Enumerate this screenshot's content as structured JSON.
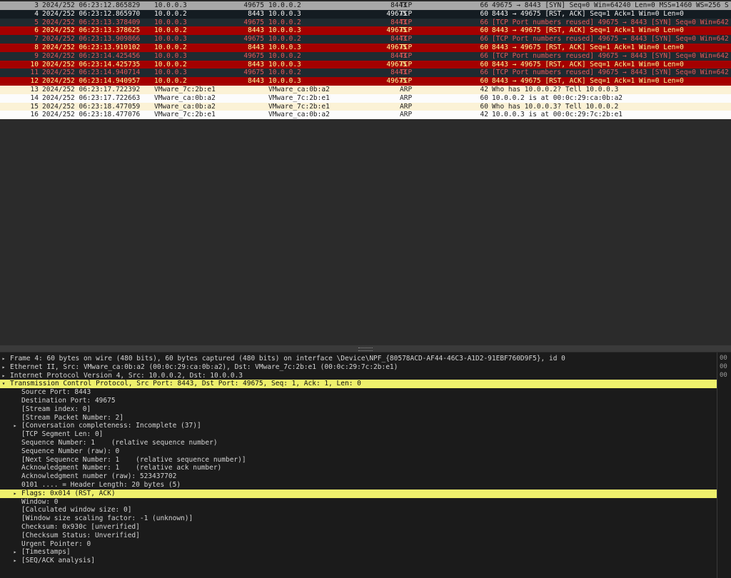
{
  "packets": [
    {
      "no": "3",
      "time": "2024/252 06:23:12.865829",
      "src": "10.0.0.3",
      "sport": "49675",
      "dst": "10.0.0.2",
      "dport": "8443",
      "proto": "TCP",
      "len": "66",
      "info": "49675 → 8443 [SYN] Seq=0 Win=64240 Len=0 MSS=1460 WS=256 S",
      "style": "gray"
    },
    {
      "no": "4",
      "time": "2024/252 06:23:12.865970",
      "src": "10.0.0.2",
      "sport": "8443",
      "dst": "10.0.0.3",
      "dport": "49675",
      "proto": "TCP",
      "len": "60",
      "info": "8443 → 49675 [RST, ACK] Seq=1 Ack=1 Win=0 Len=0",
      "style": "dark"
    },
    {
      "no": "5",
      "time": "2024/252 06:23:13.378409",
      "src": "10.0.0.3",
      "sport": "49675",
      "dst": "10.0.0.2",
      "dport": "8443",
      "proto": "TCP",
      "len": "66",
      "info": "[TCP Port numbers reused] 49675 → 8443 [SYN] Seq=0 Win=642",
      "style": "slate"
    },
    {
      "no": "6",
      "time": "2024/252 06:23:13.378625",
      "src": "10.0.0.2",
      "sport": "8443",
      "dst": "10.0.0.3",
      "dport": "49675",
      "proto": "TCP",
      "len": "60",
      "info": "8443 → 49675 [RST, ACK] Seq=1 Ack=1 Win=0 Len=0",
      "style": "red"
    },
    {
      "no": "7",
      "time": "2024/252 06:23:13.909866",
      "src": "10.0.0.3",
      "sport": "49675",
      "dst": "10.0.0.2",
      "dport": "8443",
      "proto": "TCP",
      "len": "66",
      "info": "[TCP Port numbers reused] 49675 → 8443 [SYN] Seq=0 Win=642",
      "style": "slate"
    },
    {
      "no": "8",
      "time": "2024/252 06:23:13.910102",
      "src": "10.0.0.2",
      "sport": "8443",
      "dst": "10.0.0.3",
      "dport": "49675",
      "proto": "TCP",
      "len": "60",
      "info": "8443 → 49675 [RST, ACK] Seq=1 Ack=1 Win=0 Len=0",
      "style": "red"
    },
    {
      "no": "9",
      "time": "2024/252 06:23:14.425456",
      "src": "10.0.0.3",
      "sport": "49675",
      "dst": "10.0.0.2",
      "dport": "8443",
      "proto": "TCP",
      "len": "66",
      "info": "[TCP Port numbers reused] 49675 → 8443 [SYN] Seq=0 Win=642",
      "style": "slate"
    },
    {
      "no": "10",
      "time": "2024/252 06:23:14.425735",
      "src": "10.0.0.2",
      "sport": "8443",
      "dst": "10.0.0.3",
      "dport": "49675",
      "proto": "TCP",
      "len": "60",
      "info": "8443 → 49675 [RST, ACK] Seq=1 Ack=1 Win=0 Len=0",
      "style": "red"
    },
    {
      "no": "11",
      "time": "2024/252 06:23:14.940714",
      "src": "10.0.0.3",
      "sport": "49675",
      "dst": "10.0.0.2",
      "dport": "8443",
      "proto": "TCP",
      "len": "66",
      "info": "[TCP Port numbers reused] 49675 → 8443 [SYN] Seq=0 Win=642",
      "style": "slate"
    },
    {
      "no": "12",
      "time": "2024/252 06:23:14.940957",
      "src": "10.0.0.2",
      "sport": "8443",
      "dst": "10.0.0.3",
      "dport": "49675",
      "proto": "TCP",
      "len": "60",
      "info": "8443 → 49675 [RST, ACK] Seq=1 Ack=1 Win=0 Len=0",
      "style": "red"
    },
    {
      "no": "13",
      "time": "2024/252 06:23:17.722392",
      "src": "VMware_7c:2b:e1",
      "sport": "",
      "dst": "VMware_ca:0b:a2",
      "dport": "",
      "proto": "ARP",
      "len": "42",
      "info": "Who has 10.0.0.2? Tell 10.0.0.3",
      "style": "cream"
    },
    {
      "no": "14",
      "time": "2024/252 06:23:17.722663",
      "src": "VMware_ca:0b:a2",
      "sport": "",
      "dst": "VMware_7c:2b:e1",
      "dport": "",
      "proto": "ARP",
      "len": "60",
      "info": "10.0.0.2 is at 00:0c:29:ca:0b:a2",
      "style": "white"
    },
    {
      "no": "15",
      "time": "2024/252 06:23:18.477059",
      "src": "VMware_ca:0b:a2",
      "sport": "",
      "dst": "VMware_7c:2b:e1",
      "dport": "",
      "proto": "ARP",
      "len": "60",
      "info": "Who has 10.0.0.3? Tell 10.0.0.2",
      "style": "cream"
    },
    {
      "no": "16",
      "time": "2024/252 06:23:18.477076",
      "src": "VMware_7c:2b:e1",
      "sport": "",
      "dst": "VMware_ca:0b:a2",
      "dport": "",
      "proto": "ARP",
      "len": "42",
      "info": "10.0.0.3 is at 00:0c:29:7c:2b:e1",
      "style": "white"
    }
  ],
  "details": [
    {
      "indent": 0,
      "arrow": "collapsed",
      "text": "Frame 4: 60 bytes on wire (480 bits), 60 bytes captured (480 bits) on interface \\Device\\NPF_{80578ACD-AF44-46C3-A1D2-91EBF760D9F5}, id 0"
    },
    {
      "indent": 0,
      "arrow": "collapsed",
      "text": "Ethernet II, Src: VMware_ca:0b:a2 (00:0c:29:ca:0b:a2), Dst: VMware_7c:2b:e1 (00:0c:29:7c:2b:e1)"
    },
    {
      "indent": 0,
      "arrow": "collapsed",
      "text": "Internet Protocol Version 4, Src: 10.0.0.2, Dst: 10.0.0.3"
    },
    {
      "indent": 0,
      "arrow": "expanded",
      "text": "Transmission Control Protocol, Src Port: 8443, Dst Port: 49675, Seq: 1, Ack: 1, Len: 0",
      "highlight": true
    },
    {
      "indent": 1,
      "arrow": "",
      "text": "Source Port: 8443"
    },
    {
      "indent": 1,
      "arrow": "",
      "text": "Destination Port: 49675"
    },
    {
      "indent": 1,
      "arrow": "",
      "text": "[Stream index: 0]"
    },
    {
      "indent": 1,
      "arrow": "",
      "text": "[Stream Packet Number: 2]"
    },
    {
      "indent": 1,
      "arrow": "collapsed",
      "text": "[Conversation completeness: Incomplete (37)]"
    },
    {
      "indent": 1,
      "arrow": "",
      "text": "[TCP Segment Len: 0]"
    },
    {
      "indent": 1,
      "arrow": "",
      "text": "Sequence Number: 1    (relative sequence number)"
    },
    {
      "indent": 1,
      "arrow": "",
      "text": "Sequence Number (raw): 0"
    },
    {
      "indent": 1,
      "arrow": "",
      "text": "[Next Sequence Number: 1    (relative sequence number)]"
    },
    {
      "indent": 1,
      "arrow": "",
      "text": "Acknowledgment Number: 1    (relative ack number)"
    },
    {
      "indent": 1,
      "arrow": "",
      "text": "Acknowledgment number (raw): 523437702"
    },
    {
      "indent": 1,
      "arrow": "",
      "text": "0101 .... = Header Length: 20 bytes (5)"
    },
    {
      "indent": 1,
      "arrow": "collapsed",
      "text": "Flags: 0x014 (RST, ACK)",
      "highlight": true
    },
    {
      "indent": 1,
      "arrow": "",
      "text": "Window: 0"
    },
    {
      "indent": 1,
      "arrow": "",
      "text": "[Calculated window size: 0]"
    },
    {
      "indent": 1,
      "arrow": "",
      "text": "[Window size scaling factor: -1 (unknown)]"
    },
    {
      "indent": 1,
      "arrow": "",
      "text": "Checksum: 0x930c [unverified]"
    },
    {
      "indent": 1,
      "arrow": "",
      "text": "[Checksum Status: Unverified]"
    },
    {
      "indent": 1,
      "arrow": "",
      "text": "Urgent Pointer: 0"
    },
    {
      "indent": 1,
      "arrow": "collapsed",
      "text": "[Timestamps]"
    },
    {
      "indent": 1,
      "arrow": "collapsed",
      "text": "[SEQ/ACK analysis]"
    }
  ],
  "bytes_pane": [
    "00",
    "00",
    "00"
  ],
  "icons": {
    "collapsed": "▸",
    "expanded": "▾"
  }
}
